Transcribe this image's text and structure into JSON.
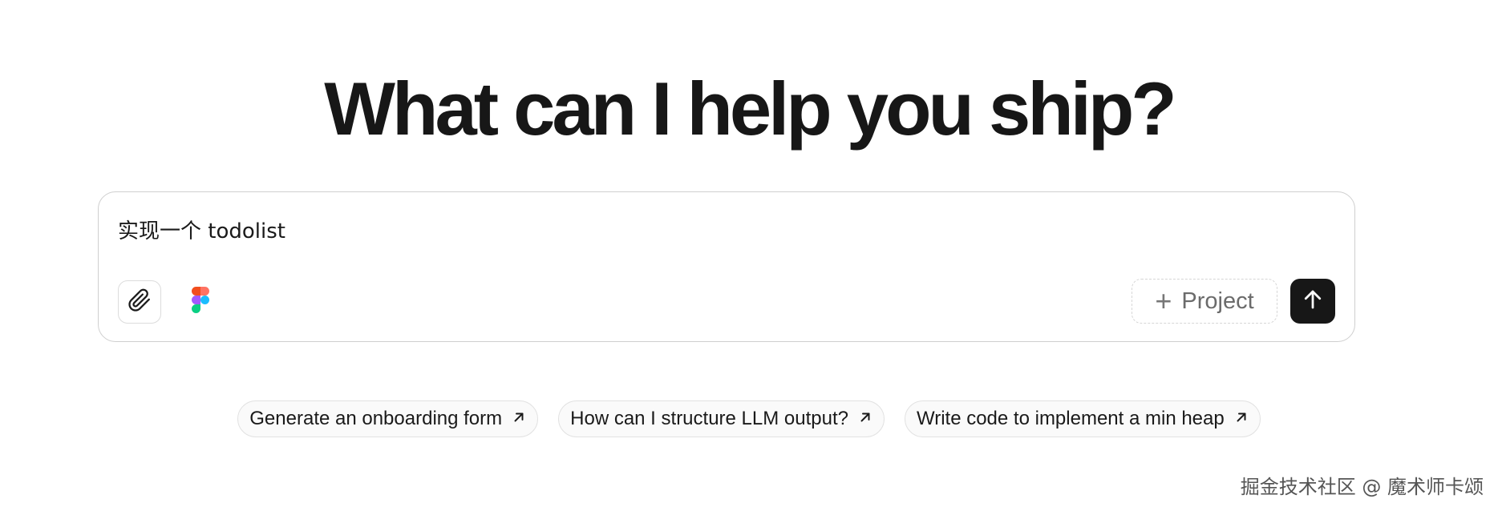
{
  "headline": "What can I help you ship?",
  "composer": {
    "input_value": "实现一个 todolist",
    "attach_icon": "paperclip-icon",
    "figma_icon": "figma-icon",
    "project_label": "Project",
    "send_icon": "arrow-up-icon"
  },
  "suggestions": [
    {
      "label": "Generate an onboarding form",
      "icon": "arrow-up-right-icon"
    },
    {
      "label": "How can I structure LLM output?",
      "icon": "arrow-up-right-icon"
    },
    {
      "label": "Write code to implement a min heap",
      "icon": "arrow-up-right-icon"
    }
  ],
  "watermark": "掘金技术社区 @ 魔术师卡颂",
  "colors": {
    "text": "#171717",
    "send_button": "#171717",
    "border": "#cfcfcf",
    "figma_red": "#F24E1E",
    "figma_orange": "#FF7262",
    "figma_purple": "#A259FF",
    "figma_blue": "#1ABCFE",
    "figma_green": "#0ACF83"
  }
}
